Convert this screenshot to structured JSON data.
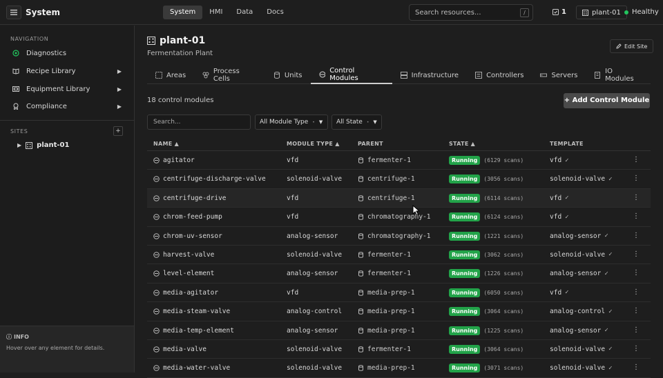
{
  "topbar": {
    "app_title": "System",
    "nav": [
      "System",
      "HMI",
      "Data",
      "Docs"
    ],
    "search_placeholder": "Search resources...",
    "search_shortcut": "/",
    "alert_count": "1",
    "site": "plant-01",
    "health": "Healthy",
    "health_color": "#22c55e"
  },
  "sidebar": {
    "nav_title": "NAVIGATION",
    "items": [
      {
        "label": "Diagnostics",
        "icon": "diagnostics-icon"
      },
      {
        "label": "Recipe Library",
        "icon": "book-icon",
        "arrow": "▶"
      },
      {
        "label": "Equipment Library",
        "icon": "equipment-icon",
        "arrow": "▶"
      },
      {
        "label": "Compliance",
        "icon": "compliance-icon",
        "arrow": "▶"
      }
    ],
    "sites_title": "SITES",
    "sites_add": "+",
    "site_item": "plant-01",
    "info_title": "INFO",
    "info_text": "Hover over any element for details."
  },
  "page": {
    "title": "plant-01",
    "subtitle": "Fermentation Plant",
    "edit_label": "Edit Site",
    "tabs": [
      "Areas",
      "Process Cells",
      "Units",
      "Control Modules",
      "Infrastructure",
      "Controllers",
      "Servers",
      "IO Modules"
    ],
    "active_tab": "Control Modules",
    "count_label": "18 control modules",
    "add_label": "+ Add Control Module",
    "filter_placeholder": "Search...",
    "type_select": "All Module Type",
    "state_select": "All State"
  },
  "table": {
    "headers": {
      "name": "NAME ▲",
      "type": "MODULE TYPE ▲",
      "parent": "PARENT",
      "state": "STATE ▲",
      "template": "TEMPLATE"
    },
    "rows": [
      {
        "name": "agitator",
        "type": "vfd",
        "parent": "fermenter-1",
        "state": "Running",
        "scans": "(6129 scans)",
        "template": "vfd"
      },
      {
        "name": "centrifuge-discharge-valve",
        "type": "solenoid-valve",
        "parent": "centrifuge-1",
        "state": "Running",
        "scans": "(3056 scans)",
        "template": "solenoid-valve"
      },
      {
        "name": "centrifuge-drive",
        "type": "vfd",
        "parent": "centrifuge-1",
        "state": "Running",
        "scans": "(6114 scans)",
        "template": "vfd"
      },
      {
        "name": "chrom-feed-pump",
        "type": "vfd",
        "parent": "chromatography-1",
        "state": "Running",
        "scans": "(6124 scans)",
        "template": "vfd"
      },
      {
        "name": "chrom-uv-sensor",
        "type": "analog-sensor",
        "parent": "chromatography-1",
        "state": "Running",
        "scans": "(1221 scans)",
        "template": "analog-sensor"
      },
      {
        "name": "harvest-valve",
        "type": "solenoid-valve",
        "parent": "fermenter-1",
        "state": "Running",
        "scans": "(3062 scans)",
        "template": "solenoid-valve"
      },
      {
        "name": "level-element",
        "type": "analog-sensor",
        "parent": "fermenter-1",
        "state": "Running",
        "scans": "(1226 scans)",
        "template": "analog-sensor"
      },
      {
        "name": "media-agitator",
        "type": "vfd",
        "parent": "media-prep-1",
        "state": "Running",
        "scans": "(6050 scans)",
        "template": "vfd"
      },
      {
        "name": "media-steam-valve",
        "type": "analog-control",
        "parent": "media-prep-1",
        "state": "Running",
        "scans": "(3064 scans)",
        "template": "analog-control"
      },
      {
        "name": "media-temp-element",
        "type": "analog-sensor",
        "parent": "media-prep-1",
        "state": "Running",
        "scans": "(1225 scans)",
        "template": "analog-sensor"
      },
      {
        "name": "media-valve",
        "type": "solenoid-valve",
        "parent": "fermenter-1",
        "state": "Running",
        "scans": "(3064 scans)",
        "template": "solenoid-valve"
      },
      {
        "name": "media-water-valve",
        "type": "solenoid-valve",
        "parent": "media-prep-1",
        "state": "Running",
        "scans": "(3071 scans)",
        "template": "solenoid-valve"
      }
    ],
    "check": "✓",
    "kebab": "⋮"
  }
}
